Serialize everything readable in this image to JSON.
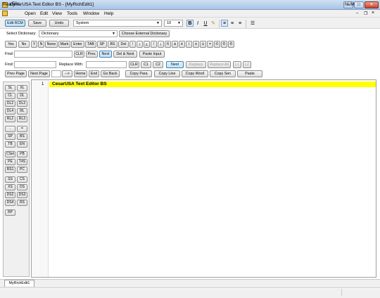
{
  "window": {
    "title": "CesarUSA Text Editor BS - [MyRichEdit1]",
    "minimize": "–",
    "maximize": "□",
    "close": "✕"
  },
  "menu": [
    "File",
    "Open",
    "Edit",
    "View",
    "Tools",
    "Window",
    "Help"
  ],
  "mdi_controls": {
    "minimize": "–",
    "restore": "❐",
    "close": "×"
  },
  "toolbar": {
    "edit_rcm": "Edit RCM",
    "save": "Save",
    "undo": "Undo",
    "font": "System",
    "font_size": "10",
    "bold": "B",
    "italic": "I",
    "underline": "U"
  },
  "dictionary": {
    "label": "Select Dictionary:",
    "value": "Dictionary",
    "choose_external": "Choose External Dictionary"
  },
  "keys": [
    "Yes",
    "No",
    "Y",
    "N",
    "None",
    "Mark",
    "Enter",
    "TAB",
    "SP",
    "BS",
    "Del",
    "!",
    "¡",
    "¿",
    "!",
    "¡",
    "ñ",
    "á",
    "é",
    "í",
    "ó",
    "ú",
    "=",
    "©",
    "®",
    "®"
  ],
  "find_row1": {
    "label": "Find:",
    "clr": "CLR",
    "prev": "Prev.",
    "next": "Next",
    "del_next": "Del & Next",
    "paste_input": "Paste Input"
  },
  "find_row2": {
    "label": "Find:",
    "replace_label": "Replace With:",
    "clr": "CLR",
    "c1": "C1",
    "c2": "C2",
    "next": "Next",
    "replace": "Replace",
    "replace_all": "Replace All",
    "l1": "L1",
    "l2": "L2"
  },
  "nav_row": {
    "prev_page": "Prev Page",
    "next_page": "Next Page",
    "arrow": "-->",
    "home": "Home",
    "end": "End",
    "go_back": "Go Back",
    "copy_para": "Copy Para",
    "copy_line": "Copy Line",
    "copy_word": "Copy Word",
    "copy_sen": "Copy Sen",
    "paste": "Paste"
  },
  "side_buttons": [
    "SL",
    "XL",
    "CL",
    "DL",
    "DL2",
    "DL3",
    "DL4",
    "RL",
    "RL2",
    "RL3",
    ".",
    "=",
    "SP",
    "BS",
    "TB",
    "EN",
    "CSel",
    "PB",
    "PE",
    "T4S",
    "RS1",
    "PC",
    "SS",
    "CS",
    "XS",
    "DS",
    "DS2",
    "DS3",
    "DS4",
    "RS",
    "RP"
  ],
  "editor": {
    "line_number": "1",
    "line_text": "CesarUSA Text Editor BS",
    "highlight_color": "#ffff00"
  },
  "tab": "MyRichEdit1",
  "status": {
    "text": "Ready",
    "num": "NUM"
  }
}
